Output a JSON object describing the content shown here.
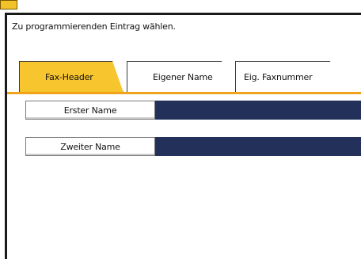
{
  "instruction": "Zu programmierenden Eintrag wählen.",
  "tabs": [
    {
      "label": "Fax-Header",
      "active": true
    },
    {
      "label": "Eigener Name",
      "active": false
    },
    {
      "label": "Eig. Faxnummer",
      "active": false
    }
  ],
  "fields": [
    {
      "label": "Erster Name",
      "value": ""
    },
    {
      "label": "Zweiter Name",
      "value": ""
    }
  ],
  "colors": {
    "active_tab": "#f7c52e",
    "tab_underline": "#f0a31a",
    "field_value_bg": "#22305a",
    "screen_border": "#1a1a1a"
  }
}
